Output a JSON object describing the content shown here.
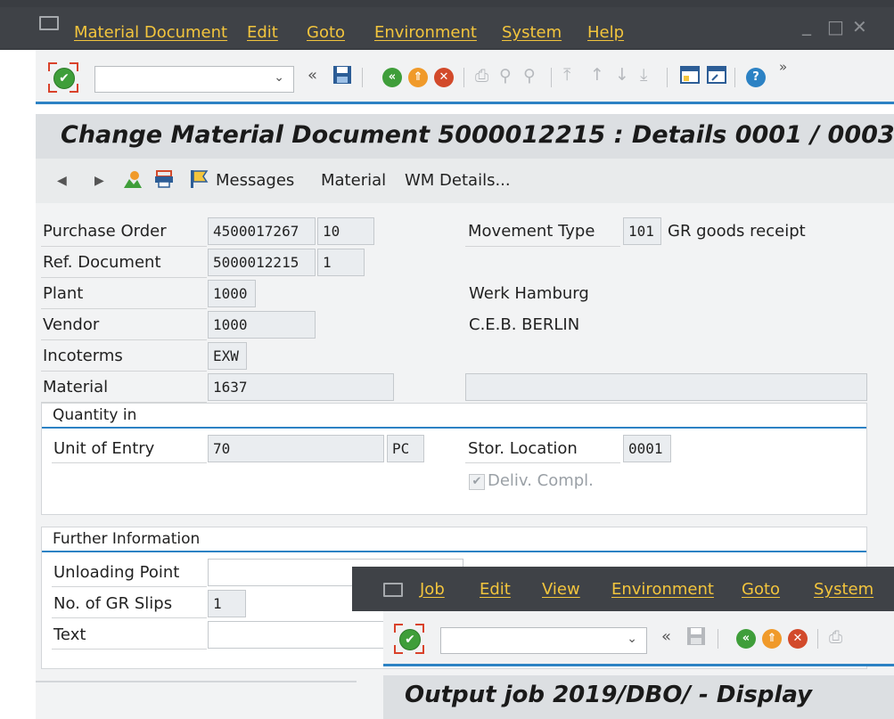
{
  "menubar": {
    "items": [
      "Material Document",
      "Edit",
      "Goto",
      "Environment",
      "System",
      "Help"
    ],
    "controls": [
      "_",
      "□",
      "✕"
    ]
  },
  "toolbar": {
    "more": "»",
    "back": "«"
  },
  "title": "Change Material Document 5000012215 : Details 0001 / 0003",
  "app_toolbar": {
    "messages": "Messages",
    "material": "Material",
    "wm_details": "WM Details..."
  },
  "form": {
    "purchase_order": {
      "label": "Purchase Order",
      "value": "4500017267",
      "item": "10"
    },
    "ref_document": {
      "label": "Ref. Document",
      "value": "5000012215",
      "item": "1"
    },
    "plant": {
      "label": "Plant",
      "value": "1000",
      "desc": "Werk Hamburg"
    },
    "vendor": {
      "label": "Vendor",
      "value": "1000",
      "desc": "C.E.B. BERLIN"
    },
    "incoterms": {
      "label": "Incoterms",
      "value": "EXW"
    },
    "material": {
      "label": "Material",
      "value": "1637",
      "desc": ""
    },
    "movement_type": {
      "label": "Movement Type",
      "value": "101",
      "desc": "GR goods receipt"
    }
  },
  "quantity_group": {
    "title": "Quantity in",
    "unit_of_entry": {
      "label": "Unit of Entry",
      "value": "70",
      "unit": "PC"
    },
    "stor_location": {
      "label": "Stor. Location",
      "value": "0001"
    },
    "deliv_compl": {
      "label": "Deliv. Compl.",
      "checked": true
    }
  },
  "further_group": {
    "title": "Further Information",
    "unloading_point": {
      "label": "Unloading Point",
      "value": ""
    },
    "gr_slips": {
      "label": "No. of GR Slips",
      "value": "1"
    },
    "text": {
      "label": "Text",
      "value": ""
    }
  },
  "overlay": {
    "menu_items": [
      "Job",
      "Edit",
      "View",
      "Environment",
      "Goto",
      "System"
    ],
    "back": "«",
    "title": "Output job 2019/DBO/ - Display"
  },
  "colors": {
    "menu_bg": "#3f4247",
    "menu_text": "#f3c53d",
    "accent_blue": "#2c82c4",
    "ok_green": "#3f9e3a",
    "nav_orange": "#f09a2a",
    "cancel_red": "#d24a2b"
  }
}
